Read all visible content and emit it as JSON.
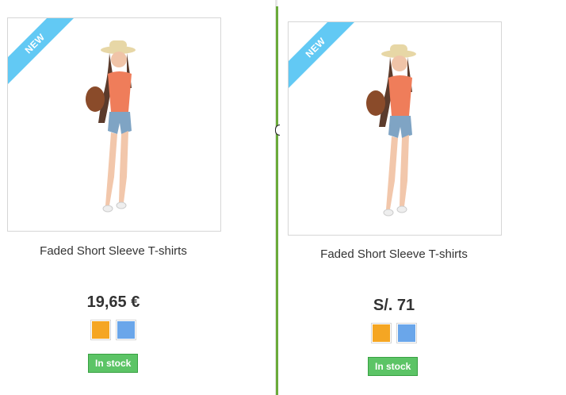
{
  "products": [
    {
      "badge": "NEW",
      "title": "Faded Short Sleeve T-shirts",
      "price": "19,65 €",
      "swatches": [
        {
          "color": "#f5a623"
        },
        {
          "color": "#6aa6ea"
        }
      ],
      "stock_label": "In stock"
    },
    {
      "badge": "NEW",
      "title": "Faded Short Sleeve T-shirts",
      "price": "S/. 71",
      "swatches": [
        {
          "color": "#f5a623"
        },
        {
          "color": "#6aa6ea"
        }
      ],
      "stock_label": "In stock"
    }
  ],
  "colors": {
    "ribbon": "#62c9f4",
    "stock_bg": "#5cc466",
    "divider": "#6aab3a"
  }
}
